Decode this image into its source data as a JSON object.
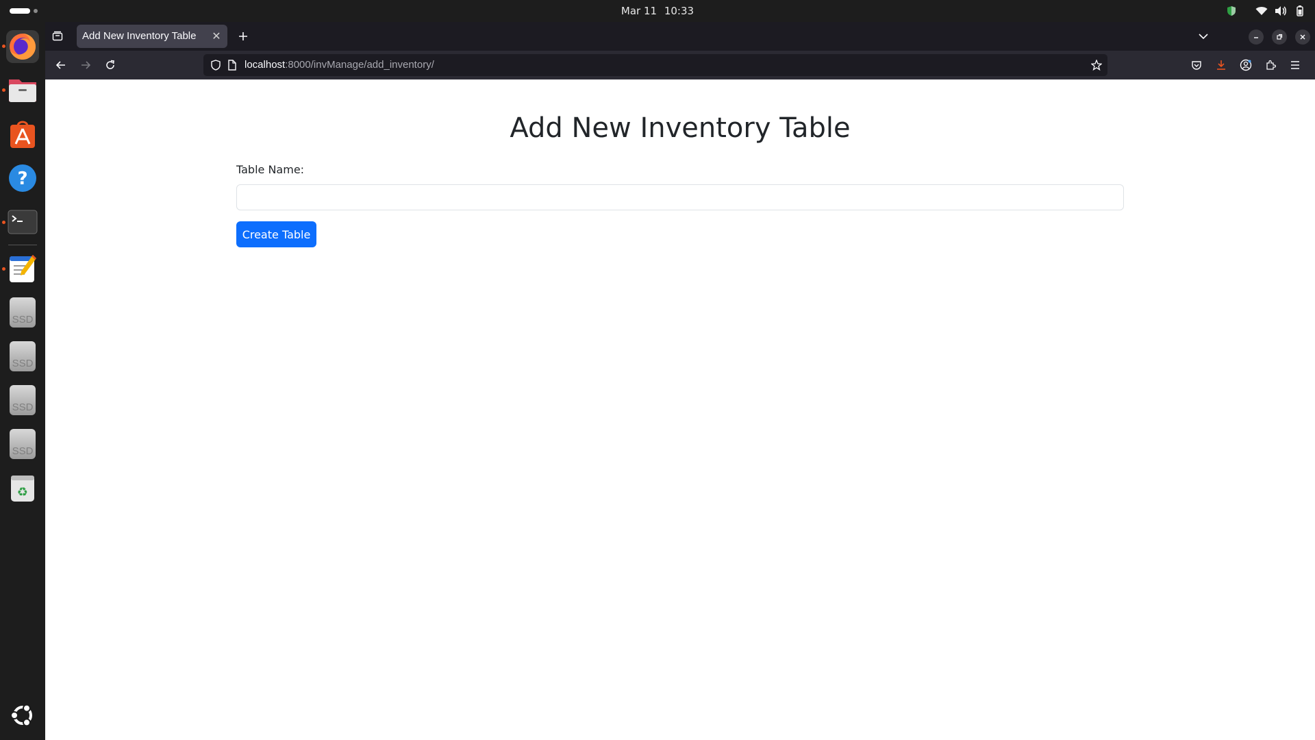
{
  "system": {
    "date": "Mar 11",
    "time": "10:33",
    "tray_icons": [
      "shield-icon",
      "wifi-icon",
      "volume-icon",
      "battery-icon"
    ]
  },
  "dock": {
    "apps": [
      "firefox-icon",
      "files-icon",
      "app-center-icon",
      "help-icon",
      "terminal-icon",
      "text-editor-icon",
      "ssd-drive-icon",
      "ssd-drive-icon",
      "ssd-drive-icon",
      "ssd-drive-icon",
      "trash-icon"
    ],
    "ssd_label": "SSD",
    "show_apps_icon": "ubuntu-logo-icon"
  },
  "browser": {
    "tab_title": "Add New Inventory Table",
    "url_host": "localhost",
    "url_path": ":8000/invManage/add_inventory/",
    "accent_color": "#e95420"
  },
  "page": {
    "title": "Add New Inventory Table",
    "label_table_name": "Table Name:",
    "input_value": "",
    "submit_label": "Create Table",
    "button_color": "#0d6efd"
  }
}
